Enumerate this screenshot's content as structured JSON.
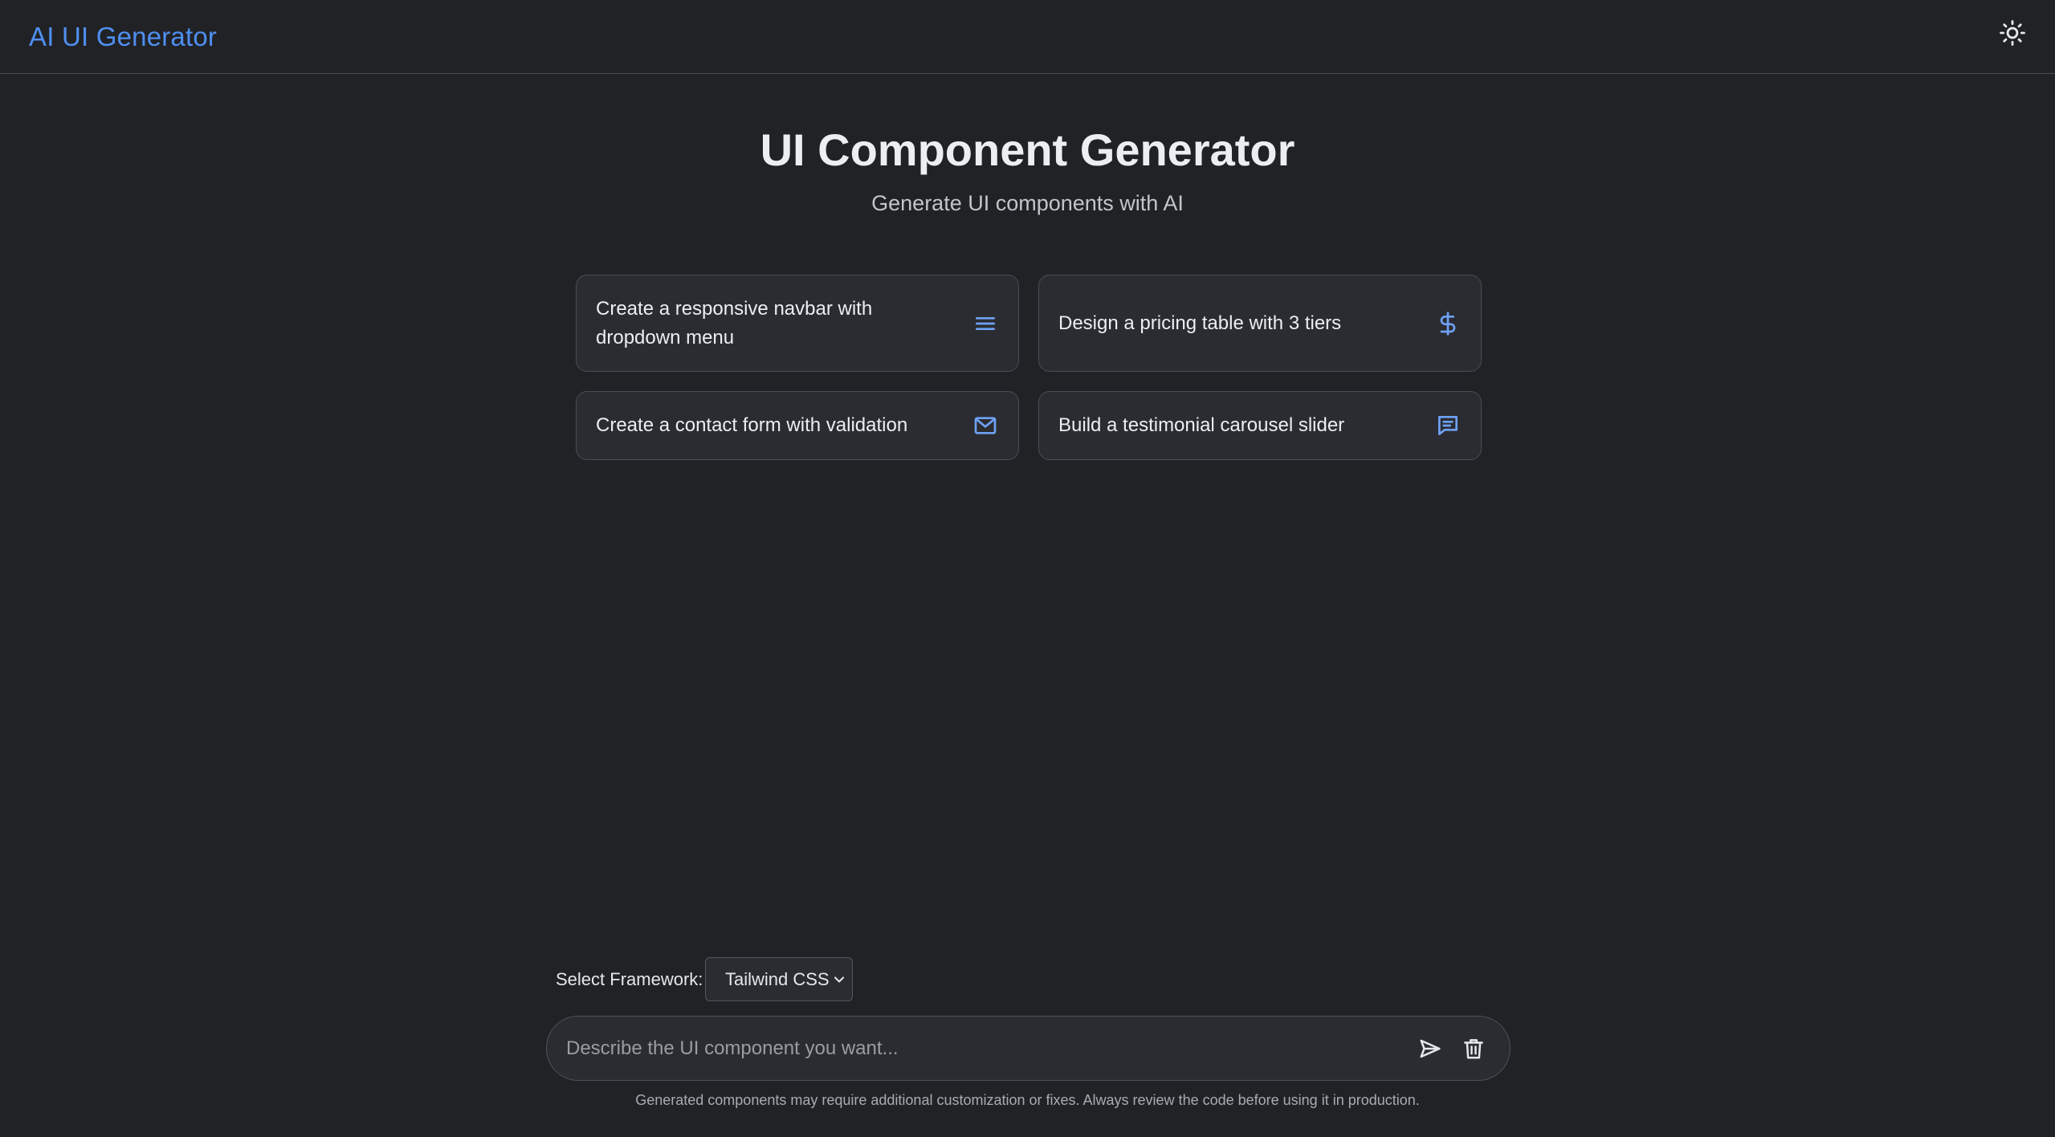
{
  "header": {
    "brand": "AI UI Generator",
    "theme_toggle_icon": "sun-icon"
  },
  "hero": {
    "title": "UI Component Generator",
    "subtitle": "Generate UI components with AI"
  },
  "suggestions": [
    {
      "label": "Create a responsive navbar with dropdown menu",
      "icon": "menu-icon"
    },
    {
      "label": "Design a pricing table with 3 tiers",
      "icon": "dollar-icon"
    },
    {
      "label": "Create a contact form with validation",
      "icon": "mail-icon"
    },
    {
      "label": "Build a testimonial carousel slider",
      "icon": "message-square-icon"
    }
  ],
  "framework": {
    "label": "Select Framework:",
    "selected": "Tailwind CSS"
  },
  "prompt": {
    "placeholder": "Describe the UI component you want...",
    "value": "",
    "send_icon": "send-icon",
    "clear_icon": "trash-icon"
  },
  "footer": {
    "disclaimer": "Generated components may require additional customization or fixes. Always review the code before using it in production."
  },
  "colors": {
    "background": "#212226",
    "accent": "#4f8ff0",
    "card": "#2b2c31"
  }
}
